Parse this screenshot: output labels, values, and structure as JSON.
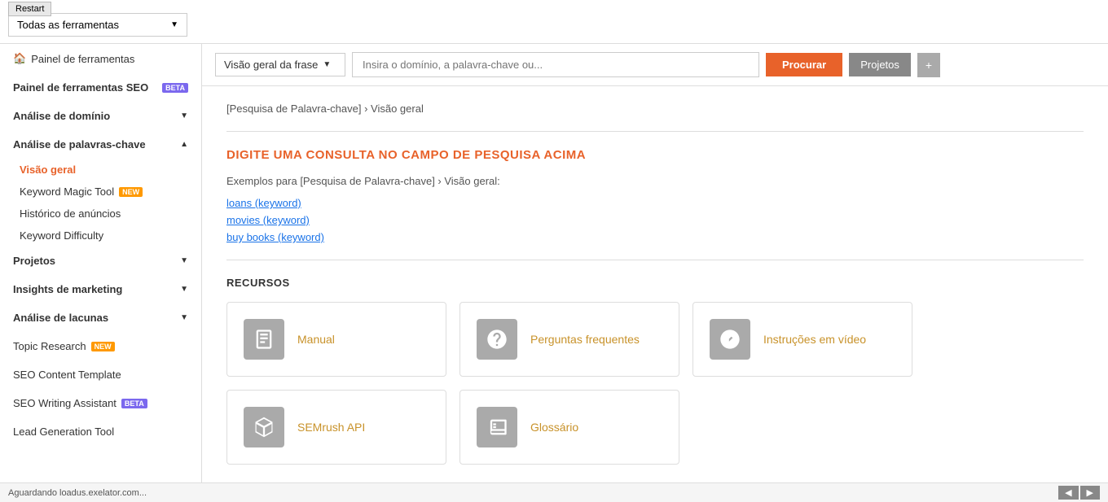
{
  "restart_label": "Restart",
  "all_tools": "Todas as ferramentas",
  "sidebar": {
    "painel_ferramentas": "Painel de ferramentas",
    "painel_ferramentas_seo": "Painel de ferramentas SEO",
    "analise_dominio": "Análise de domínio",
    "analise_palavras": "Análise de palavras-chave",
    "visao_geral": "Visão geral",
    "keyword_magic": "Keyword Magic Tool",
    "historico_anuncios": "Histórico de anúncios",
    "keyword_difficulty": "Keyword Difficulty",
    "projetos": "Projetos",
    "insights_marketing": "Insights de marketing",
    "analise_lacunas": "Análise de lacunas",
    "topic_research": "Topic Research",
    "seo_content_template": "SEO Content Template",
    "seo_writing_assistant": "SEO Writing Assistant",
    "lead_generation": "Lead Generation Tool"
  },
  "search_bar": {
    "dropdown_label": "Visão geral da frase",
    "input_placeholder": "Insira o domínio, a palavra-chave ou...",
    "search_btn": "Procurar",
    "projects_btn": "Projetos",
    "plus": "+"
  },
  "breadcrumb": "[Pesquisa de Palavra-chave] › Visão geral",
  "main_title": "DIGITE UMA CONSULTA NO CAMPO DE PESQUISA ACIMA",
  "examples_intro": "Exemplos para [Pesquisa de Palavra-chave] › Visão geral:",
  "examples": [
    "loans (keyword)",
    "movies (keyword)",
    "buy books (keyword)"
  ],
  "recursos_title": "RECURSOS",
  "resources_row1": [
    {
      "label": "Manual",
      "icon": "book"
    },
    {
      "label": "Perguntas frequentes",
      "icon": "question"
    },
    {
      "label": "Instruções em vídeo",
      "icon": "video"
    }
  ],
  "resources_row2": [
    {
      "label": "SEMrush API",
      "icon": "box"
    },
    {
      "label": "Glossário",
      "icon": "book-open"
    }
  ],
  "status_bar": "Aguardando loadus.exelator.com..."
}
